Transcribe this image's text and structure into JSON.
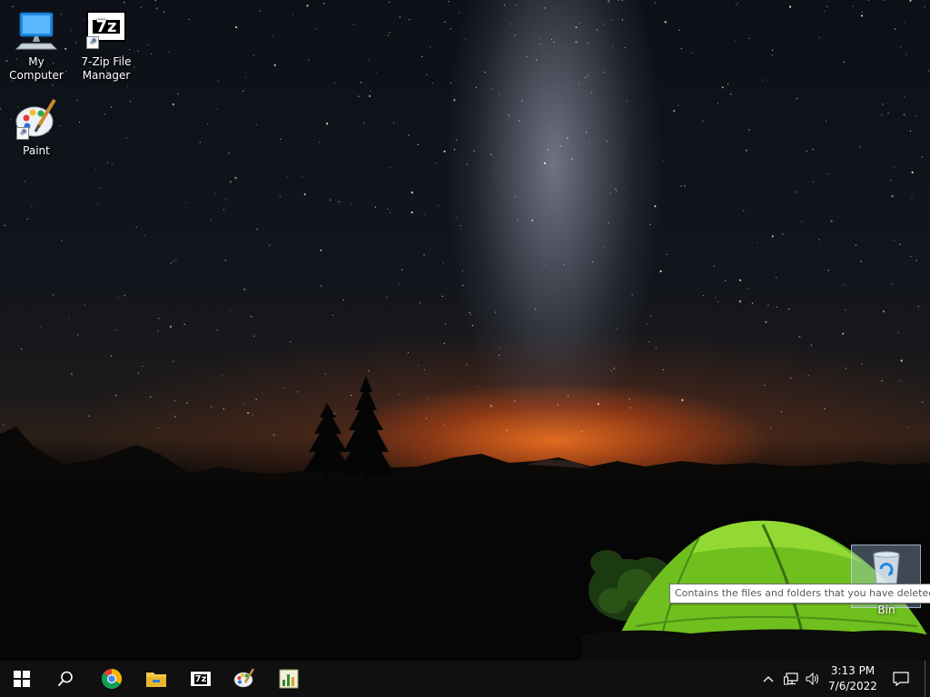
{
  "desktop": {
    "icons": [
      {
        "label": "My Computer",
        "icon": "computer-icon"
      },
      {
        "label": "7-Zip File Manager",
        "icon": "7zip-icon",
        "glyph": "7z"
      },
      {
        "label": "Paint",
        "icon": "paint-icon"
      }
    ],
    "recycle_bin": {
      "label": "Recycle Bin",
      "icon": "recycle-bin-icon"
    },
    "tooltip": "Contains the files and folders that you have deleted."
  },
  "taskbar": {
    "buttons": [
      {
        "name": "start",
        "icon": "windows-icon"
      },
      {
        "name": "search",
        "icon": "search-icon"
      },
      {
        "name": "chrome",
        "icon": "chrome-icon"
      },
      {
        "name": "file-explorer",
        "icon": "folder-icon"
      },
      {
        "name": "7zip",
        "icon": "7zip-icon",
        "glyph": "7z"
      },
      {
        "name": "paint",
        "icon": "paint-icon"
      },
      {
        "name": "app",
        "icon": "chart-app-icon"
      }
    ],
    "tray": {
      "icons": [
        "chevron-up-icon",
        "network-icon",
        "volume-icon"
      ],
      "time": "3:13 PM",
      "date": "7/6/2022",
      "notification_icon": "notification-icon"
    }
  },
  "colors": {
    "taskbar": "#101010",
    "tooltip_border": "#767676",
    "accent": "#0078d7"
  }
}
